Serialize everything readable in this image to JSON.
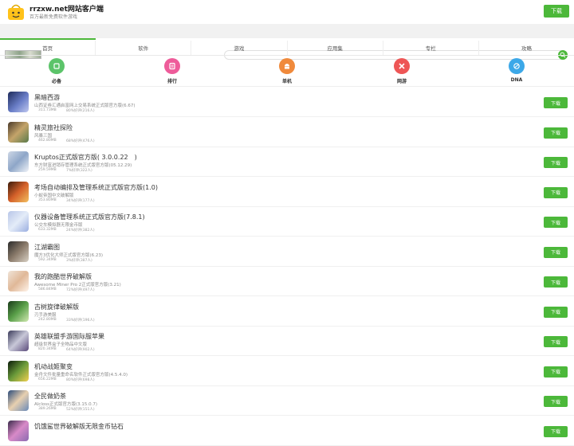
{
  "header": {
    "title": "rrzxw.net网站客户端",
    "subtitle": "百万最新免费软件游戏",
    "download_label": "下载"
  },
  "search": {
    "placeholder": ""
  },
  "nav": {
    "tabs": [
      {
        "label": "首页"
      },
      {
        "label": "软件"
      },
      {
        "label": "游戏"
      },
      {
        "label": "应用集"
      },
      {
        "label": "专栏"
      },
      {
        "label": "攻略"
      }
    ],
    "active_index": 0
  },
  "categories": [
    {
      "label": "必备",
      "icon": "must-have-icon",
      "color": "#5cc46a"
    },
    {
      "label": "排行",
      "icon": "ranking-icon",
      "color": "#ee5c9a"
    },
    {
      "label": "单机",
      "icon": "android-icon",
      "color": "#f08a3c"
    },
    {
      "label": "网游",
      "icon": "gamepad-icon",
      "color": "#ee5656"
    },
    {
      "label": "DNA",
      "icon": "dna-icon",
      "color": "#3ca8e8"
    }
  ],
  "apps": [
    {
      "name": "黑暗西游",
      "desc": "山西证券汇通启富网上交易系统正式版官方版(6.67)",
      "size": "311.73MB",
      "rating": "80%好评(216人)",
      "download_label": "下载"
    },
    {
      "name": "精灵旅社探险",
      "desc": "风暴三国",
      "size": "462.80MB",
      "rating": "68%好评(476人)",
      "download_label": "下载"
    },
    {
      "name": "Kruptos正式版官方版( 3.0.0.22　)",
      "desc": "东方财富进销存管理系统正式版官方版(05.12.29)",
      "size": "259.59MB",
      "rating": "7%好评(322人)",
      "download_label": "下载"
    },
    {
      "name": "考场自动编排及管理系统正式版官方版(1.0)",
      "desc": "小蚁帝国中文破解版",
      "size": "353.80MB",
      "rating": "34%好评(177人)",
      "download_label": "下载"
    },
    {
      "name": "仪器设备管理系统正式版官方版(7.8.1)",
      "desc": "公交车模拟器无限金币版",
      "size": "633.32MB",
      "rating": "24%好评(382人)",
      "download_label": "下载"
    },
    {
      "name": "江湖霸图",
      "desc": "魔方3优化大师正式版官方版(6.23)",
      "size": "592.34MB",
      "rating": "3%好评(387人)",
      "download_label": "下载"
    },
    {
      "name": "我的跑酷世界破解版",
      "desc": "Awesome Miner Pro 2正式版官方版(3.21)",
      "size": "586.84MB",
      "rating": "72%好评(497人)",
      "download_label": "下载"
    },
    {
      "name": "古树旋律破解版",
      "desc": "刃手游美服",
      "size": "242.80MB",
      "rating": "33%好评(196人)",
      "download_label": "下载"
    },
    {
      "name": "英雄联盟手游国际服苹果",
      "desc": "超级世界盒子全物品中文版",
      "size": "820.34MB",
      "rating": "64%好评(902人)",
      "download_label": "下载"
    },
    {
      "name": "机动战姬聚变",
      "desc": "金舟文件批量重命名软件正式版官方版(4.5.4.0)",
      "size": "656.22MB",
      "rating": "80%好评(698人)",
      "download_label": "下载"
    },
    {
      "name": "全民做奶茶",
      "desc": "Alcloss正式版官方版(3.15.0.7)",
      "size": "389.26MB",
      "rating": "52%好评(151人)",
      "download_label": "下载"
    },
    {
      "name": "饥饿鲨世界破解版无限金币钻石",
      "desc": "",
      "size": "",
      "rating": "",
      "download_label": "下载"
    }
  ]
}
